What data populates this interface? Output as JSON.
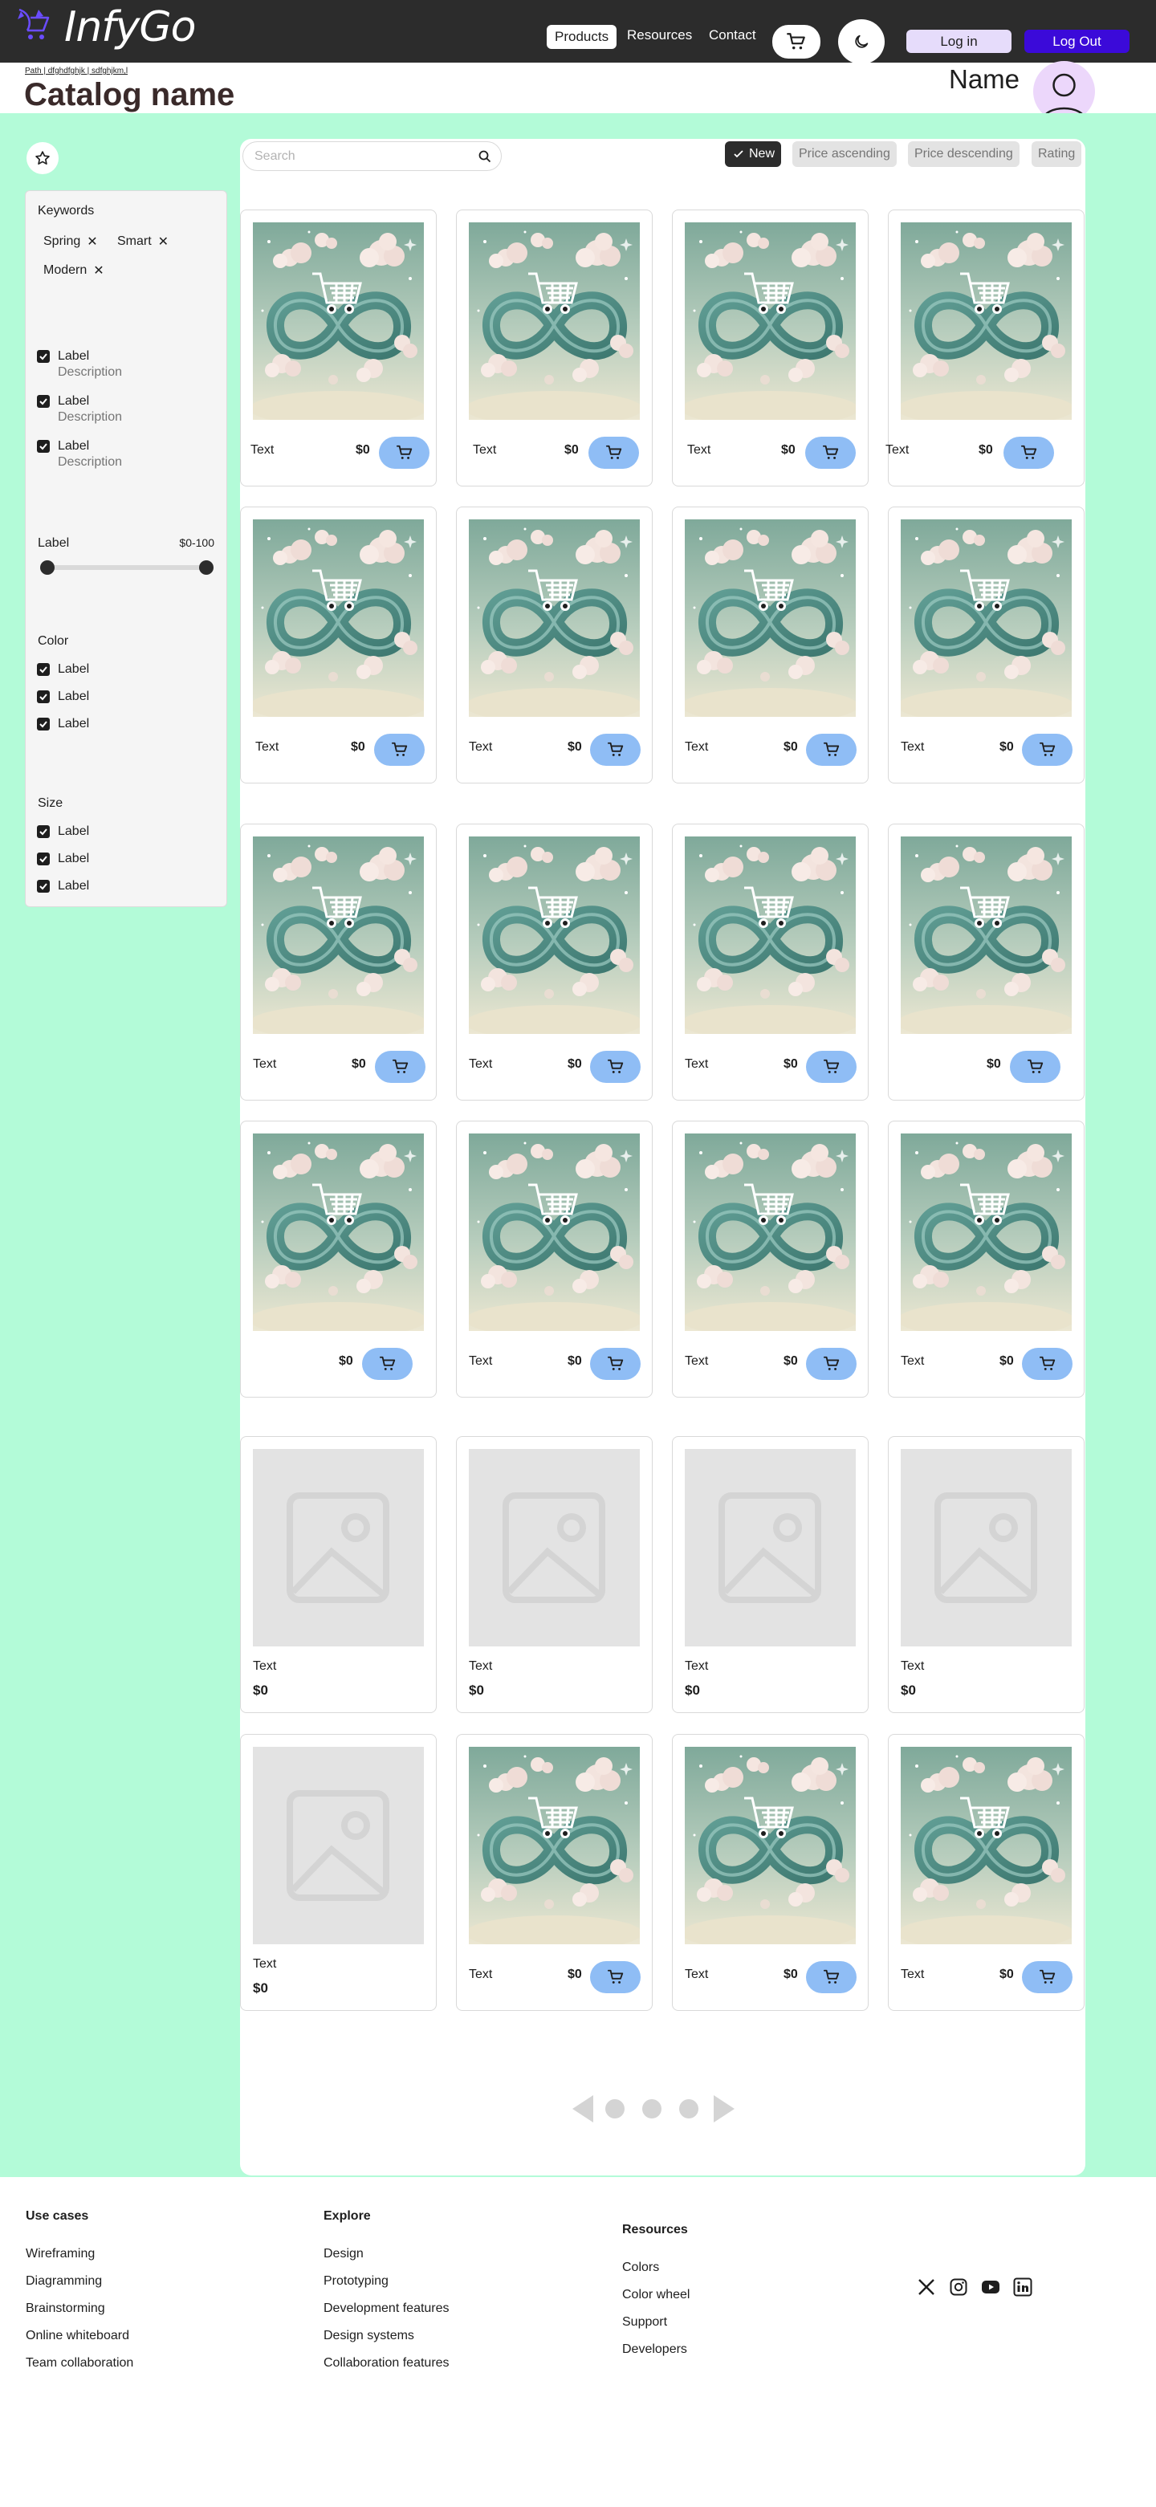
{
  "header": {
    "brand": "InfyGo",
    "nav": [
      "Products",
      "Resources",
      "Contact"
    ],
    "login_label": "Log in",
    "logout_label": "Log Out",
    "accent_color": "#3b0ad9"
  },
  "breadcrumb": "Path | dfghdfghjk | sdfghjkm,l",
  "page_title": "Catalog name",
  "user": {
    "name": "Name"
  },
  "filters": {
    "keywords_heading": "Keywords",
    "chips": [
      "Spring",
      "Smart",
      "Modern"
    ],
    "checkbox_items": [
      {
        "label": "Label",
        "description": "Description"
      },
      {
        "label": "Label",
        "description": "Description"
      },
      {
        "label": "Label",
        "description": "Description"
      }
    ],
    "range": {
      "label": "Label",
      "value": "$0-100",
      "min": 0,
      "max": 100
    },
    "color": {
      "heading": "Color",
      "items": [
        "Label",
        "Label",
        "Label"
      ]
    },
    "size": {
      "heading": "Size",
      "items": [
        "Label",
        "Label",
        "Label"
      ]
    }
  },
  "toolbar": {
    "search_placeholder": "Search",
    "sort_options": [
      "New",
      "Price ascending",
      "Price descending",
      "Rating"
    ],
    "selected_sort": "New"
  },
  "products": {
    "row1": [
      {
        "text": "Text",
        "price": "$0"
      },
      {
        "text": "Text",
        "price": "$0"
      },
      {
        "text": "Text",
        "price": "$0"
      },
      {
        "text": "Text",
        "price": "$0"
      }
    ],
    "row2": [
      {
        "text": "Text",
        "price": "$0"
      },
      {
        "text": "Text",
        "price": "$0"
      },
      {
        "text": "Text",
        "price": "$0"
      },
      {
        "text": "Text",
        "price": "$0"
      }
    ],
    "row3": [
      {
        "text": "Text",
        "price": "$0"
      },
      {
        "text": "Text",
        "price": "$0"
      },
      {
        "text": "Text",
        "price": "$0"
      },
      {
        "text": "",
        "price": "$0"
      }
    ],
    "row4": [
      {
        "text": "",
        "price": "$0"
      },
      {
        "text": "Text",
        "price": "$0"
      },
      {
        "text": "Text",
        "price": "$0"
      },
      {
        "text": "Text",
        "price": "$0"
      }
    ],
    "row5": [
      {
        "text": "Text",
        "price": "$0"
      },
      {
        "text": "Text",
        "price": "$0"
      },
      {
        "text": "Text",
        "price": "$0"
      },
      {
        "text": "Text",
        "price": "$0"
      }
    ],
    "row6": [
      {
        "text": "Text",
        "price": "$0"
      },
      {
        "text": "Text",
        "price": "$0"
      },
      {
        "text": "Text",
        "price": "$0"
      },
      {
        "text": "Text",
        "price": "$0"
      }
    ]
  },
  "pagination": {
    "pages": 3
  },
  "footer": {
    "use_cases": {
      "heading": "Use cases",
      "links": [
        "Wireframing",
        "Diagramming",
        "Brainstorming",
        "Online whiteboard",
        "Team collaboration"
      ]
    },
    "explore": {
      "heading": "Explore",
      "links": [
        "Design",
        "Prototyping",
        "Development features",
        "Design systems",
        "Collaboration features"
      ]
    },
    "resources": {
      "heading": "Resources",
      "links": [
        "Colors",
        "Color wheel",
        "Support",
        "Developers"
      ]
    },
    "socials": [
      "x-icon",
      "instagram-icon",
      "youtube-icon",
      "linkedin-icon"
    ]
  }
}
